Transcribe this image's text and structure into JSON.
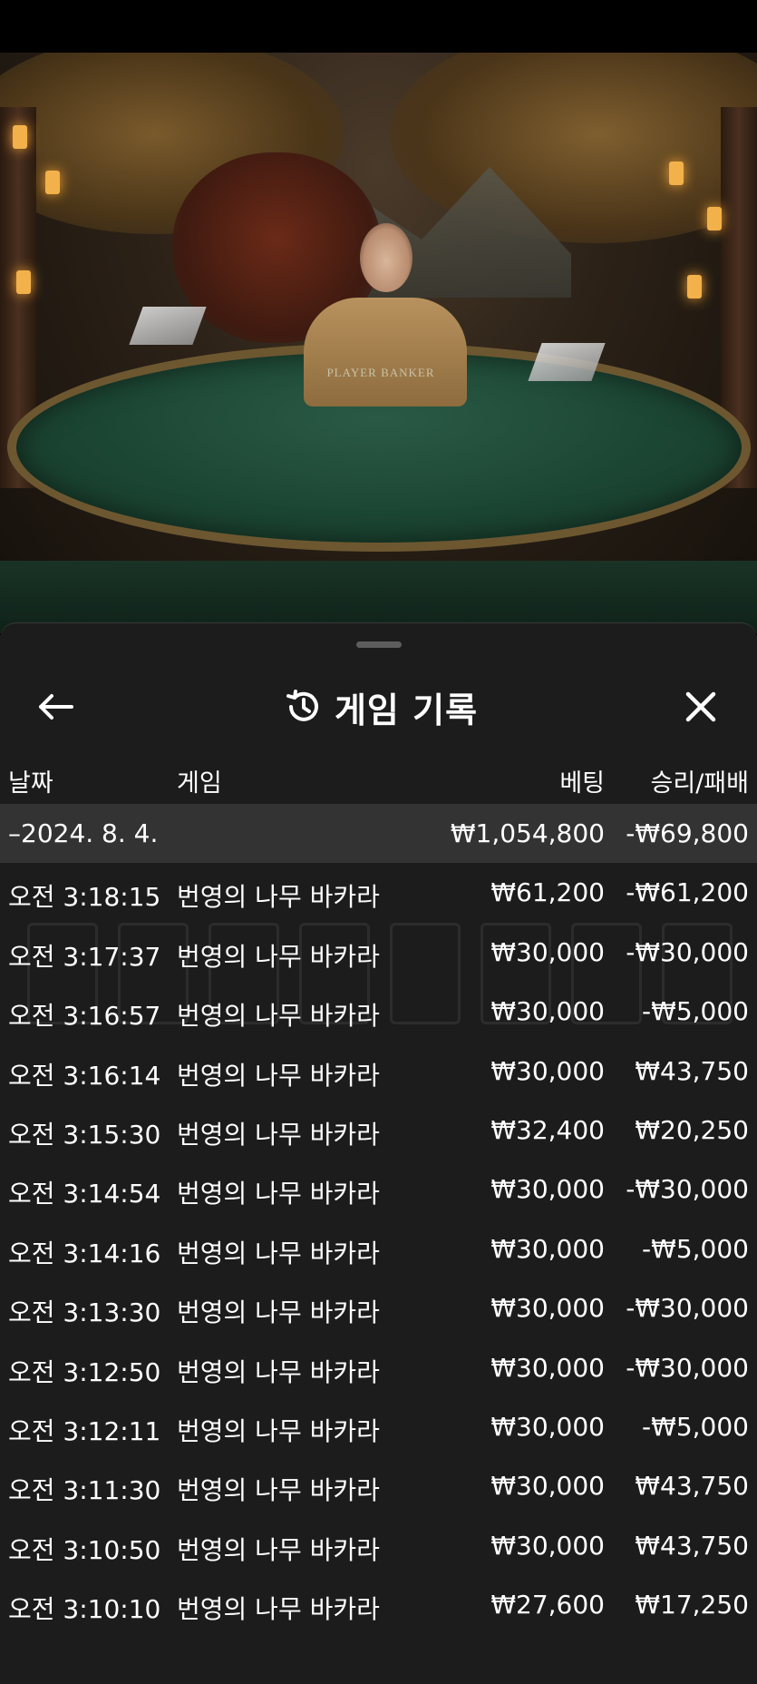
{
  "sheet": {
    "title": "게임 기록",
    "icons": {
      "back": "arrow-left-icon",
      "history": "history-icon",
      "close": "close-icon"
    }
  },
  "columns": {
    "date": "날짜",
    "game": "게임",
    "bet": "베팅",
    "winloss": "승리/패배"
  },
  "summary": {
    "date": "–2024. 8. 4.",
    "bet": "₩1,054,800",
    "winloss": "-₩69,800"
  },
  "rows": [
    {
      "time": "오전 3:18:15",
      "game": "번영의 나무 바카라",
      "bet": "₩61,200",
      "winloss": "-₩61,200"
    },
    {
      "time": "오전 3:17:37",
      "game": "번영의 나무 바카라",
      "bet": "₩30,000",
      "winloss": "-₩30,000"
    },
    {
      "time": "오전 3:16:57",
      "game": "번영의 나무 바카라",
      "bet": "₩30,000",
      "winloss": "-₩5,000"
    },
    {
      "time": "오전 3:16:14",
      "game": "번영의 나무 바카라",
      "bet": "₩30,000",
      "winloss": "₩43,750"
    },
    {
      "time": "오전 3:15:30",
      "game": "번영의 나무 바카라",
      "bet": "₩32,400",
      "winloss": "₩20,250"
    },
    {
      "time": "오전 3:14:54",
      "game": "번영의 나무 바카라",
      "bet": "₩30,000",
      "winloss": "-₩30,000"
    },
    {
      "time": "오전 3:14:16",
      "game": "번영의 나무 바카라",
      "bet": "₩30,000",
      "winloss": "-₩5,000"
    },
    {
      "time": "오전 3:13:30",
      "game": "번영의 나무 바카라",
      "bet": "₩30,000",
      "winloss": "-₩30,000"
    },
    {
      "time": "오전 3:12:50",
      "game": "번영의 나무 바카라",
      "bet": "₩30,000",
      "winloss": "-₩30,000"
    },
    {
      "time": "오전 3:12:11",
      "game": "번영의 나무 바카라",
      "bet": "₩30,000",
      "winloss": "-₩5,000"
    },
    {
      "time": "오전 3:11:30",
      "game": "번영의 나무 바카라",
      "bet": "₩30,000",
      "winloss": "₩43,750"
    },
    {
      "time": "오전 3:10:50",
      "game": "번영의 나무 바카라",
      "bet": "₩30,000",
      "winloss": "₩43,750"
    },
    {
      "time": "오전 3:10:10",
      "game": "번영의 나무 바카라",
      "bet": "₩27,600",
      "winloss": "₩17,250"
    }
  ],
  "stream": {
    "table_label": "PLAYER  BANKER"
  },
  "colors": {
    "sheet_bg": "#1c1c1c",
    "summary_bg": "#333333",
    "text": "#ffffff"
  }
}
